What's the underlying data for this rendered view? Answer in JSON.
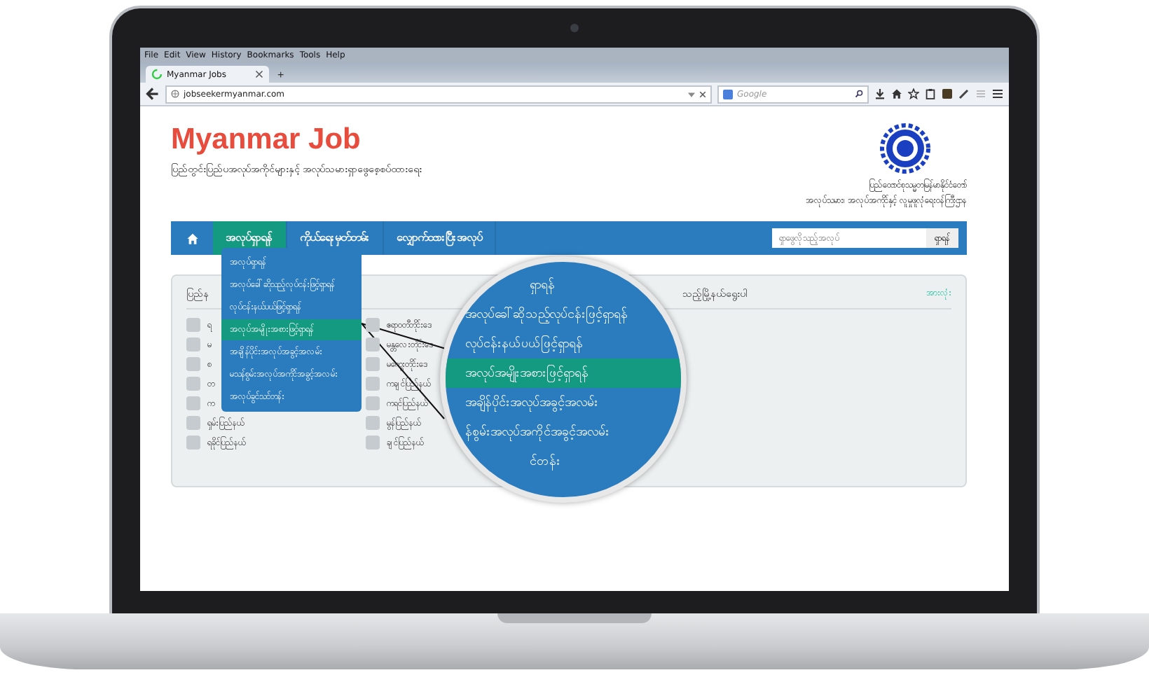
{
  "browser": {
    "menu": [
      "File",
      "Edit",
      "View",
      "History",
      "Bookmarks",
      "Tools",
      "Help"
    ],
    "tab": {
      "title": "Myanmar Jobs"
    },
    "new_tab": "+",
    "url": "jobseekermyanmar.com",
    "search_placeholder": "Google"
  },
  "site": {
    "title": "Myanmar Job",
    "subtitle": "ပြည်တွင်းပြည်ပအလုပ်အကိုင်များနှင့် အလုပ်သမားရှာဖွေစေ့စပ်ထားရေး",
    "ministry": [
      "ပြည်ထောင်စုသမ္မတမြန်မာနိုင်ငံတော်",
      "အလုပ်သမား၊ အလုပ်အကိုင်နှင့် လူမှုဖူလုံရေးဝန်ကြီးဌာန"
    ]
  },
  "nav": {
    "items": [
      {
        "label": "အလုပ်ရှာရန်",
        "selected": true
      },
      {
        "label": "ကိုယ်ရေးမှတ်တမ်း",
        "selected": false
      },
      {
        "label": "လျှောက်ထားပြီးအလုပ်",
        "selected": false
      }
    ],
    "search": {
      "placeholder": "ရှာဖွေလိုသည့်အလုပ်",
      "button": "ရှာရန်"
    }
  },
  "dropdown": {
    "items": [
      {
        "label": "အလုပ်ရှာရန်",
        "selected": false
      },
      {
        "label": "အလုပ်ခေါ်ဆိုသည့်လုပ်ငန်းဖြင့်ရှာရန်",
        "selected": false
      },
      {
        "label": "လုပ်ငန်းနယ်ပယ်ဖြင့်ရှာရန်",
        "selected": false
      },
      {
        "label": "အလုပ်အမျိုးအစားဖြင့်ရှာရန်",
        "selected": true
      },
      {
        "label": "အချိန်ပိုင်းအလုပ်အခွင့်အလမ်း",
        "selected": false
      },
      {
        "label": "မသန်စွမ်းအလုပ်အကိုင်အခွင့်အလမ်း",
        "selected": false
      },
      {
        "label": "အလုပ်ခွင်သင်တန်း",
        "selected": false
      }
    ]
  },
  "states_panel": {
    "title": "ပြည်န",
    "checkboxes": [
      {
        "label": "ရ",
        "checked": false
      },
      {
        "label": "ဧရာဝတီတိုင်းဒေ",
        "checked": false
      },
      {
        "label": "မ",
        "checked": false
      },
      {
        "label": "မန္တလေးတိုင်းဒေ",
        "checked": false
      },
      {
        "label": "စ",
        "checked": false
      },
      {
        "label": "မကွေးတိုင်းဒေ",
        "checked": false
      },
      {
        "label": "တ",
        "checked": false
      },
      {
        "label": "ကချင်ပြည်နယ်",
        "checked": false
      },
      {
        "label": "က",
        "checked": false
      },
      {
        "label": "ကရင်ပြည်နယ်",
        "checked": false
      },
      {
        "label": "ရှမ်းပြည်နယ်",
        "checked": false
      },
      {
        "label": "မွန်ပြည်နယ်",
        "checked": false
      },
      {
        "label": "ရခိုင်ပြည်နယ်",
        "checked": false
      },
      {
        "label": "ချင်ပြည်နယ်",
        "checked": false
      }
    ]
  },
  "township_panel": {
    "title": "သည့်မြို့နယ်ရွေးပါ",
    "link": "အားလုံး"
  },
  "magnifier": {
    "items": [
      {
        "label": "ရှာရန်",
        "selected": false
      },
      {
        "label": "အလုပ်ခေါ်ဆိုသည့်လုပ်ငန်းဖြင့်ရှာရန်",
        "selected": false
      },
      {
        "label": "လုပ်ငန်းနယ်ပယ်ဖြင့်ရှာရန်",
        "selected": false
      },
      {
        "label": "အလုပ်အမျိုးအစားဖြင့်ရှာရန်",
        "selected": true
      },
      {
        "label": "အချိန်ပိုင်းအလုပ်အခွင့်အလမ်း",
        "selected": false
      },
      {
        "label": "န်စွမ်းအလုပ်အကိုင်အခွင့်အလမ်း",
        "selected": false
      },
      {
        "label": "င်တန်း",
        "selected": false
      }
    ]
  }
}
